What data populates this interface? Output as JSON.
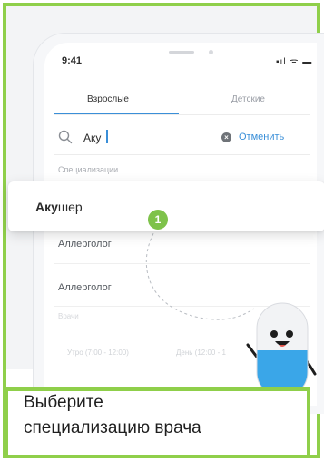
{
  "status_bar": {
    "time": "9:41",
    "indicators": "▪ıl ᯤ ▬"
  },
  "tabs": [
    {
      "label": "Взрослые",
      "active": true
    },
    {
      "label": "Детские",
      "active": false
    }
  ],
  "search": {
    "query": "Аку",
    "cancel_label": "Отменить"
  },
  "sections": {
    "specializations": "Специализации",
    "doctors": "Врачи"
  },
  "suggestion": {
    "match": "Аку",
    "rest": "шер"
  },
  "list_items": [
    "Аллерголог",
    "Аллерголог"
  ],
  "time_slots": [
    "Утро (7:00 - 12:00)",
    "День (12:00 - 1"
  ],
  "step_badge": "1",
  "caption": {
    "line1": "Выберите",
    "line2": "специализацию врача"
  },
  "colors": {
    "frame_green": "#8fcf4a",
    "accent_blue": "#3a8fd8",
    "step_green": "#7ec24a",
    "pill_blue": "#3aa6e8"
  }
}
